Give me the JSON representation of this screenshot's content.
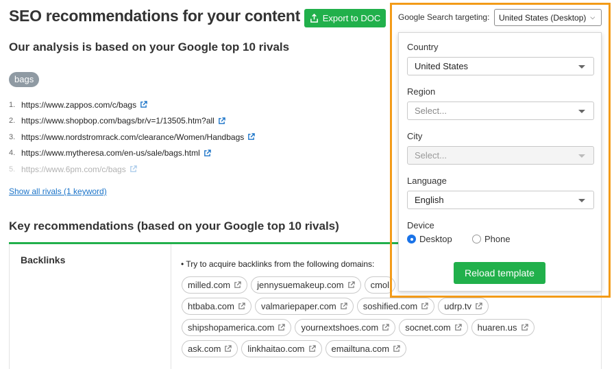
{
  "header": {
    "title": "SEO recommendations for your content",
    "export_label": "Export to DOC",
    "subtitle": "Our analysis is based on your Google top 10 rivals"
  },
  "keyword": "bags",
  "rivals": [
    {
      "num": "1.",
      "url": "https://www.zappos.com/c/bags"
    },
    {
      "num": "2.",
      "url": "https://www.shopbop.com/bags/br/v=1/13505.htm?all"
    },
    {
      "num": "3.",
      "url": "https://www.nordstromrack.com/clearance/Women/Handbags"
    },
    {
      "num": "4.",
      "url": "https://www.mytheresa.com/en-us/sale/bags.html"
    },
    {
      "num": "5.",
      "url": "https://www.6pm.com/c/bags"
    }
  ],
  "show_all_label": "Show all rivals (1 keyword)",
  "key_recommendations": {
    "title": "Key recommendations (based on your Google top 10 rivals)",
    "backlinks": {
      "label": "Backlinks",
      "text": "• Try to acquire backlinks from the following domains:",
      "rows": [
        [
          "milled.com",
          "jennysuemakeup.com",
          "cmol"
        ],
        [
          "htbaba.com",
          "valmariepaper.com",
          "soshified.com",
          "udrp.tv"
        ],
        [
          "shipshopamerica.com",
          "yournextshoes.com",
          "socnet.com",
          "huaren.us"
        ],
        [
          "ask.com",
          "linkhaitao.com",
          "emailtuna.com"
        ]
      ]
    }
  },
  "targeting": {
    "label": "Google Search targeting:",
    "value": "United States (Desktop)",
    "country_label": "Country",
    "country_value": "United States",
    "region_label": "Region",
    "region_placeholder": "Select...",
    "city_label": "City",
    "city_placeholder": "Select...",
    "language_label": "Language",
    "language_value": "English",
    "device_label": "Device",
    "device_desktop": "Desktop",
    "device_phone": "Phone",
    "device_selected": "Desktop",
    "reload_label": "Reload template"
  },
  "colors": {
    "accent_green": "#21b04b",
    "link_blue": "#1a73c8",
    "highlight_orange": "#f39b18",
    "badge_gray": "#8f9aa3"
  }
}
